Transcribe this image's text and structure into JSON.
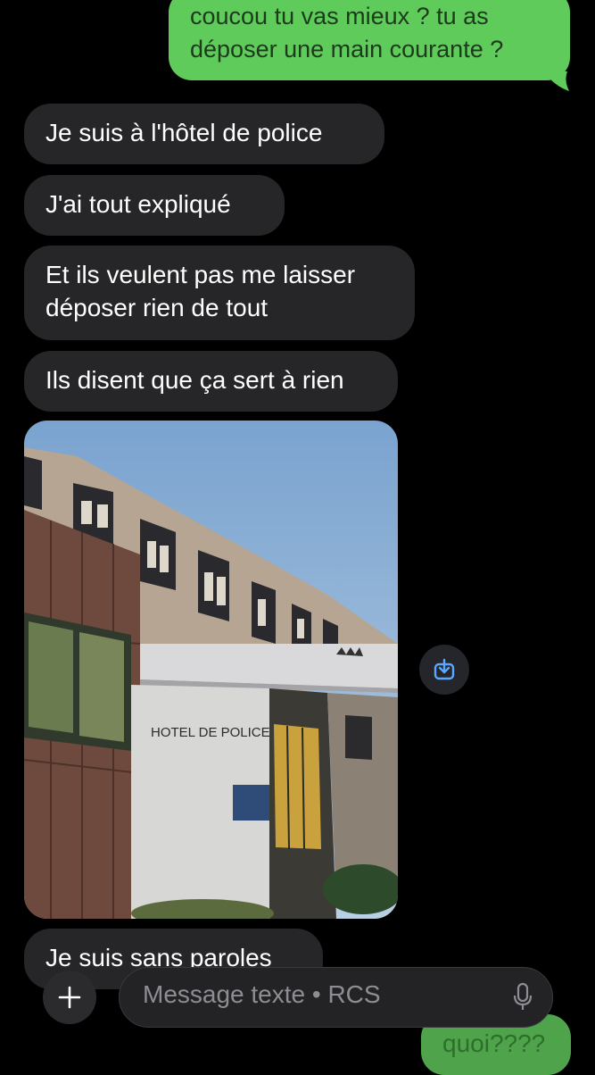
{
  "conversation": {
    "outgoing_top": "coucou tu vas mieux ? tu as déposer une main courante ?",
    "outgoing_top_line1": "coucou tu vas mieux ? tu as",
    "outgoing_top_line2": "déposer une main courante ?",
    "incoming": [
      {
        "text": "Je suis à l'hôtel de police"
      },
      {
        "text": "J'ai tout expliqué"
      },
      {
        "text_line1": "Et ils veulent pas me laisser",
        "text_line2": "déposer rien de tout"
      },
      {
        "text": "Ils disent que ça sert à rien"
      }
    ],
    "photo": {
      "building_sign": "HOTEL DE POLICE"
    },
    "last_incoming": "Je suis sans paroles",
    "outgoing_bottom": "quoi????"
  },
  "composer": {
    "placeholder": "Message texte • RCS"
  },
  "icons": {
    "save": "save-to-device-icon",
    "plus": "plus-icon",
    "mic": "microphone-icon"
  },
  "colors": {
    "outgoing_bubble": "#5fcb5b",
    "incoming_bubble": "#262629",
    "accent_blue": "#4a90e2"
  }
}
